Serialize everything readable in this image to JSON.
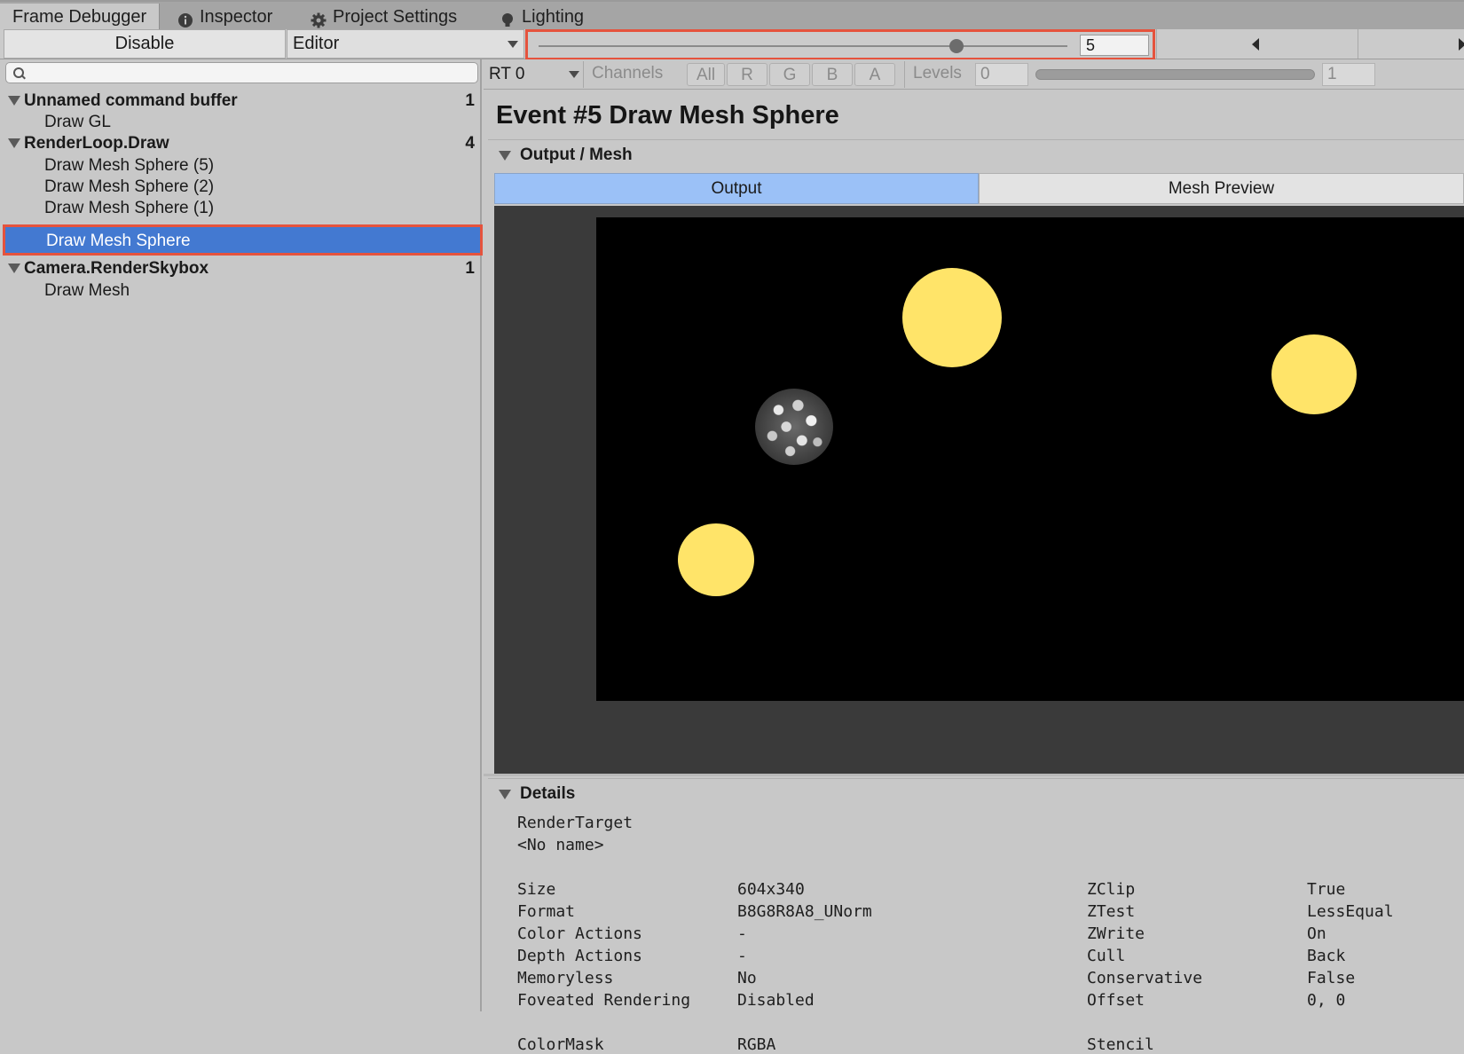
{
  "tabs": [
    {
      "label": "Frame Debugger",
      "icon": null
    },
    {
      "label": "Inspector",
      "icon": "info-icon"
    },
    {
      "label": "Project Settings",
      "icon": "gear-icon"
    },
    {
      "label": "Lighting",
      "icon": "bulb-icon"
    }
  ],
  "toolbar": {
    "disable_label": "Disable",
    "target_select": "Editor",
    "frame_value": "5",
    "slider_fraction": 0.79
  },
  "tree": {
    "search_placeholder": "",
    "groups": [
      {
        "label": "Unnamed command buffer",
        "count": "1",
        "children": [
          "Draw GL"
        ]
      },
      {
        "label": "RenderLoop.Draw",
        "count": "4",
        "children": [
          "Draw Mesh Sphere (5)",
          "Draw Mesh Sphere (2)",
          "Draw Mesh Sphere (1)",
          "Draw Mesh Sphere"
        ]
      },
      {
        "label": "Camera.RenderSkybox",
        "count": "1",
        "children": [
          "Draw Mesh"
        ]
      }
    ],
    "selected": "Draw Mesh Sphere"
  },
  "rt_bar": {
    "rt_select": "RT 0",
    "channels_label": "Channels",
    "channels": [
      "All",
      "R",
      "G",
      "B",
      "A"
    ],
    "levels_label": "Levels",
    "levels_min": "0",
    "levels_max": "1"
  },
  "event": {
    "title": "Event #5 Draw Mesh Sphere",
    "section_output": "Output / Mesh",
    "tab_output": "Output",
    "tab_mesh_preview": "Mesh Preview",
    "section_details": "Details"
  },
  "details": {
    "render_target_label": "RenderTarget",
    "render_target_value": "<No name>",
    "left": [
      {
        "key": "Size",
        "value": "604x340"
      },
      {
        "key": "Format",
        "value": "B8G8R8A8_UNorm"
      },
      {
        "key": "Color Actions",
        "value": "-"
      },
      {
        "key": "Depth Actions",
        "value": "-"
      },
      {
        "key": "Memoryless",
        "value": "No"
      },
      {
        "key": "Foveated Rendering",
        "value": "Disabled"
      }
    ],
    "right": [
      {
        "key": "ZClip",
        "value": "True"
      },
      {
        "key": "ZTest",
        "value": "LessEqual"
      },
      {
        "key": "ZWrite",
        "value": "On"
      },
      {
        "key": "Cull",
        "value": "Back"
      },
      {
        "key": "Conservative",
        "value": "False"
      },
      {
        "key": "Offset",
        "value": "0, 0"
      }
    ],
    "colormask_key": "ColorMask",
    "colormask_value": "RGBA",
    "stencil_key": "Stencil"
  },
  "colors": {
    "selection": "#4379d1",
    "highlight_box": "#e5533d",
    "output_tab": "#9bc1f7",
    "sphere": "#ffe469"
  }
}
